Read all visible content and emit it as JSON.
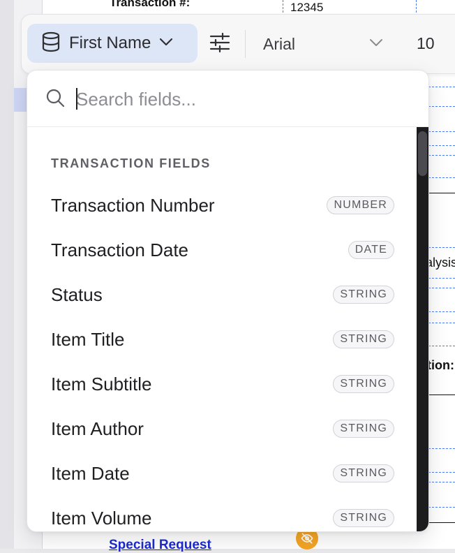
{
  "document": {
    "transaction_label": "Transaction #:",
    "transaction_value": "12345",
    "partial_text_1": "alysis",
    "partial_text_2": "tion:",
    "special_request_label": "Special Request"
  },
  "toolbar": {
    "field_button_label": "First Name",
    "font_family": "Arial",
    "font_size": "10"
  },
  "dropdown": {
    "search_placeholder": "Search fields...",
    "section_title": "TRANSACTION FIELDS",
    "fields": [
      {
        "name": "Transaction Number",
        "type": "NUMBER"
      },
      {
        "name": "Transaction Date",
        "type": "DATE"
      },
      {
        "name": "Status",
        "type": "STRING"
      },
      {
        "name": "Item Title",
        "type": "STRING"
      },
      {
        "name": "Item Subtitle",
        "type": "STRING"
      },
      {
        "name": "Item Author",
        "type": "STRING"
      },
      {
        "name": "Item Date",
        "type": "STRING"
      },
      {
        "name": "Item Volume",
        "type": "STRING"
      }
    ]
  },
  "colors": {
    "accent_button_bg": "#dde6f6",
    "dashed_guides": "#4a7df0",
    "link_blue": "#1c2bd1",
    "hidden_badge": "#f5a524"
  },
  "icons": {
    "field_button": "database-icon",
    "settings": "sliders-icon",
    "search": "search-icon",
    "hidden": "eye-off-icon"
  }
}
